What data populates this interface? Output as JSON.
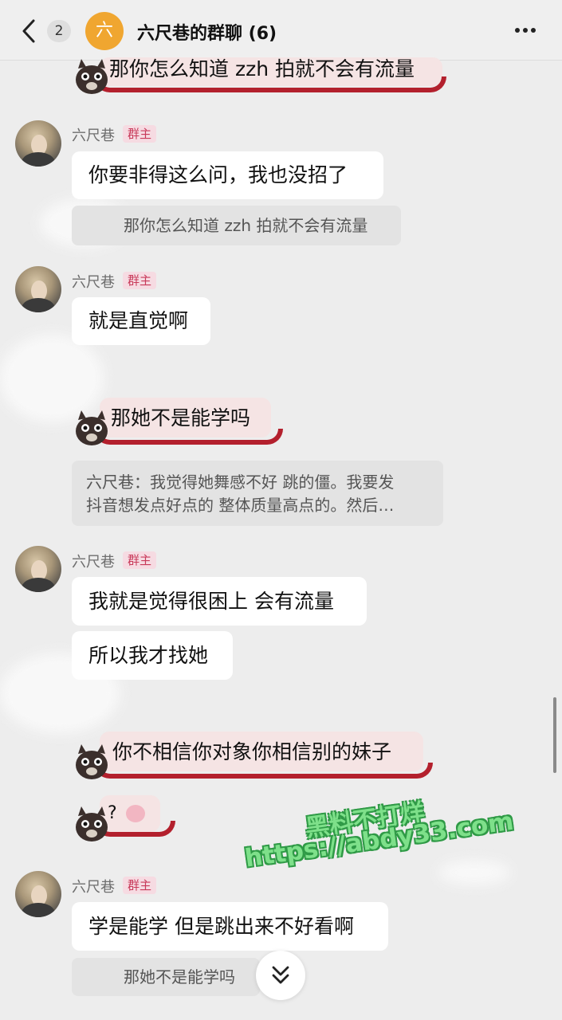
{
  "header": {
    "unread_count": "2",
    "group_avatar_char": "六",
    "title": "六尺巷的群聊 (6)"
  },
  "messages": {
    "top_sticker_text": "那你怎么知道 zzh 拍就不会有流量",
    "msg1": {
      "sender": "六尺巷",
      "badge": "群主",
      "text": "你要非得这么问，我也没招了",
      "quote": "那你怎么知道 zzh 拍就不会有流量"
    },
    "msg2": {
      "sender": "六尺巷",
      "badge": "群主",
      "text": "就是直觉啊"
    },
    "sticker2_text": "那她不是能学吗",
    "quote_block_line1": "六尺巷：我觉得她舞感不好 跳的僵。我要发",
    "quote_block_line2": "抖音想发点好点的 整体质量高点的。然后…",
    "msg3": {
      "sender": "六尺巷",
      "badge": "群主",
      "text1": "我就是觉得很困上 会有流量",
      "text2": "所以我才找她"
    },
    "sticker3_text": "你不相信你对象你相信别的妹子",
    "sticker4_text": "?",
    "msg4": {
      "sender": "六尺巷",
      "badge": "群主",
      "text": "学是能学 但是跳出来不好看啊",
      "quote": "那她不是能学吗"
    }
  },
  "watermark": {
    "line1": "黑料不打烊",
    "line2": "https://abdy33.com"
  },
  "icons": {
    "back": "chevron-left-icon",
    "more": "more-dots-icon",
    "scroll_down": "double-chevron-down-icon",
    "sticker": "cat-sticker-icon"
  }
}
